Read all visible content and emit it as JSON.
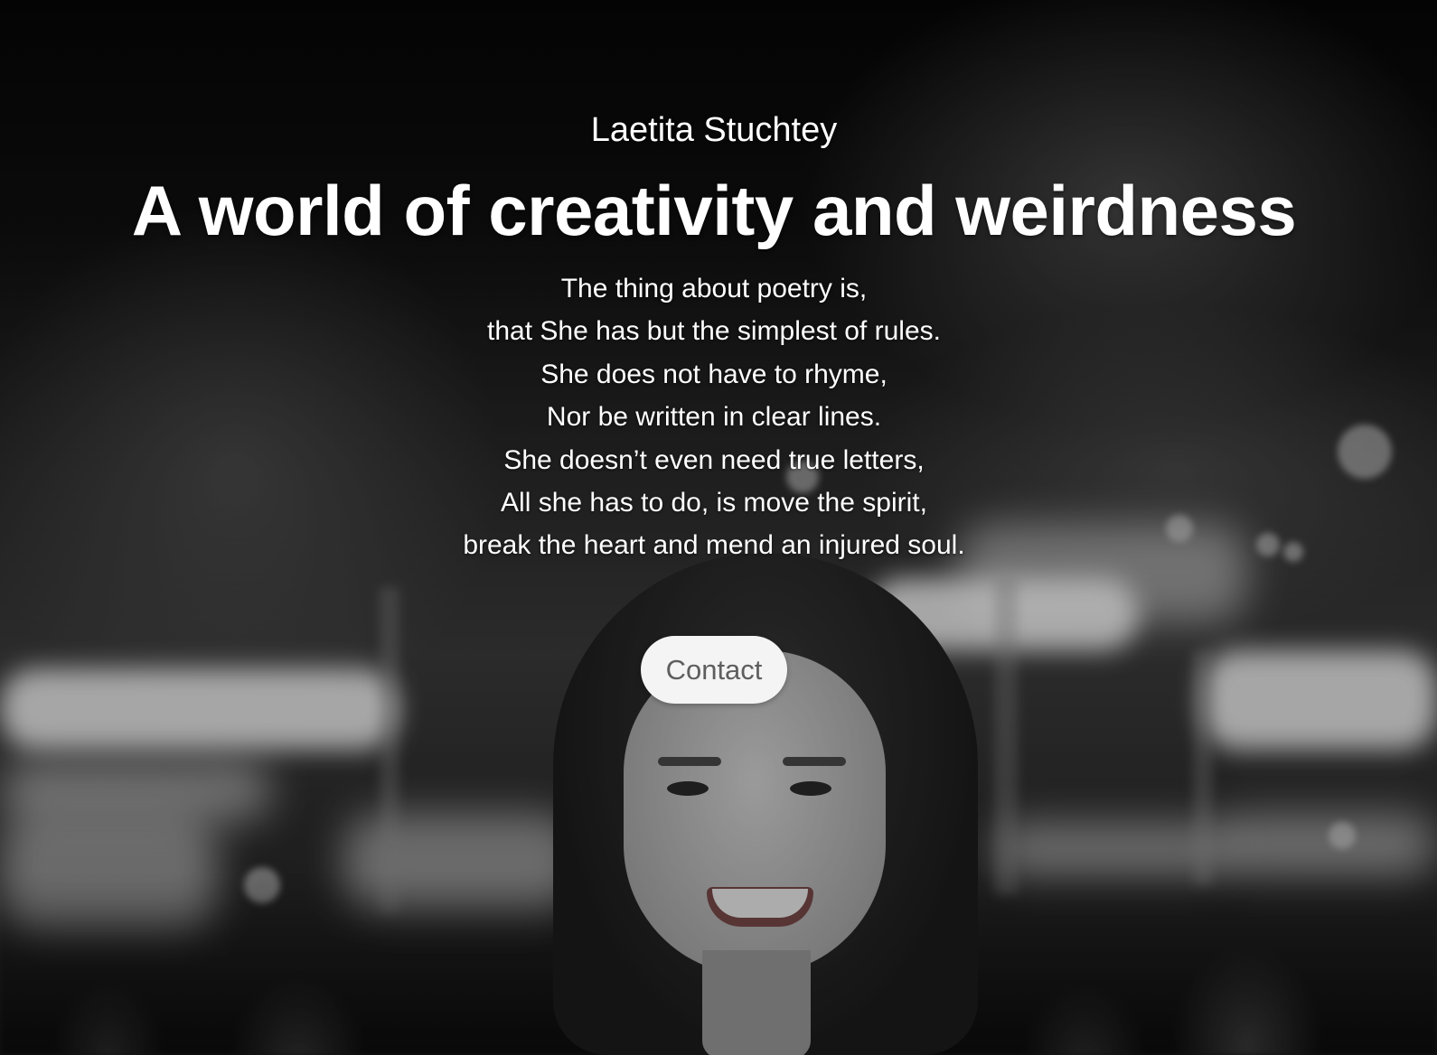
{
  "hero": {
    "author_name": "Laetita Stuchtey",
    "headline": "A world of creativity and weirdness",
    "poem_lines": [
      "The thing about poetry is,",
      "that She has but the simplest of rules.",
      "She does not have to rhyme,",
      "Nor be written in clear lines.",
      "She doesn’t even need true letters,",
      "All she has to do, is move the spirit,",
      "break the heart and mend an injured soul."
    ],
    "contact_label": "Contact"
  },
  "colors": {
    "text": "#ffffff",
    "button_background": "#f4f4f4",
    "button_text": "#5e5e5e"
  }
}
